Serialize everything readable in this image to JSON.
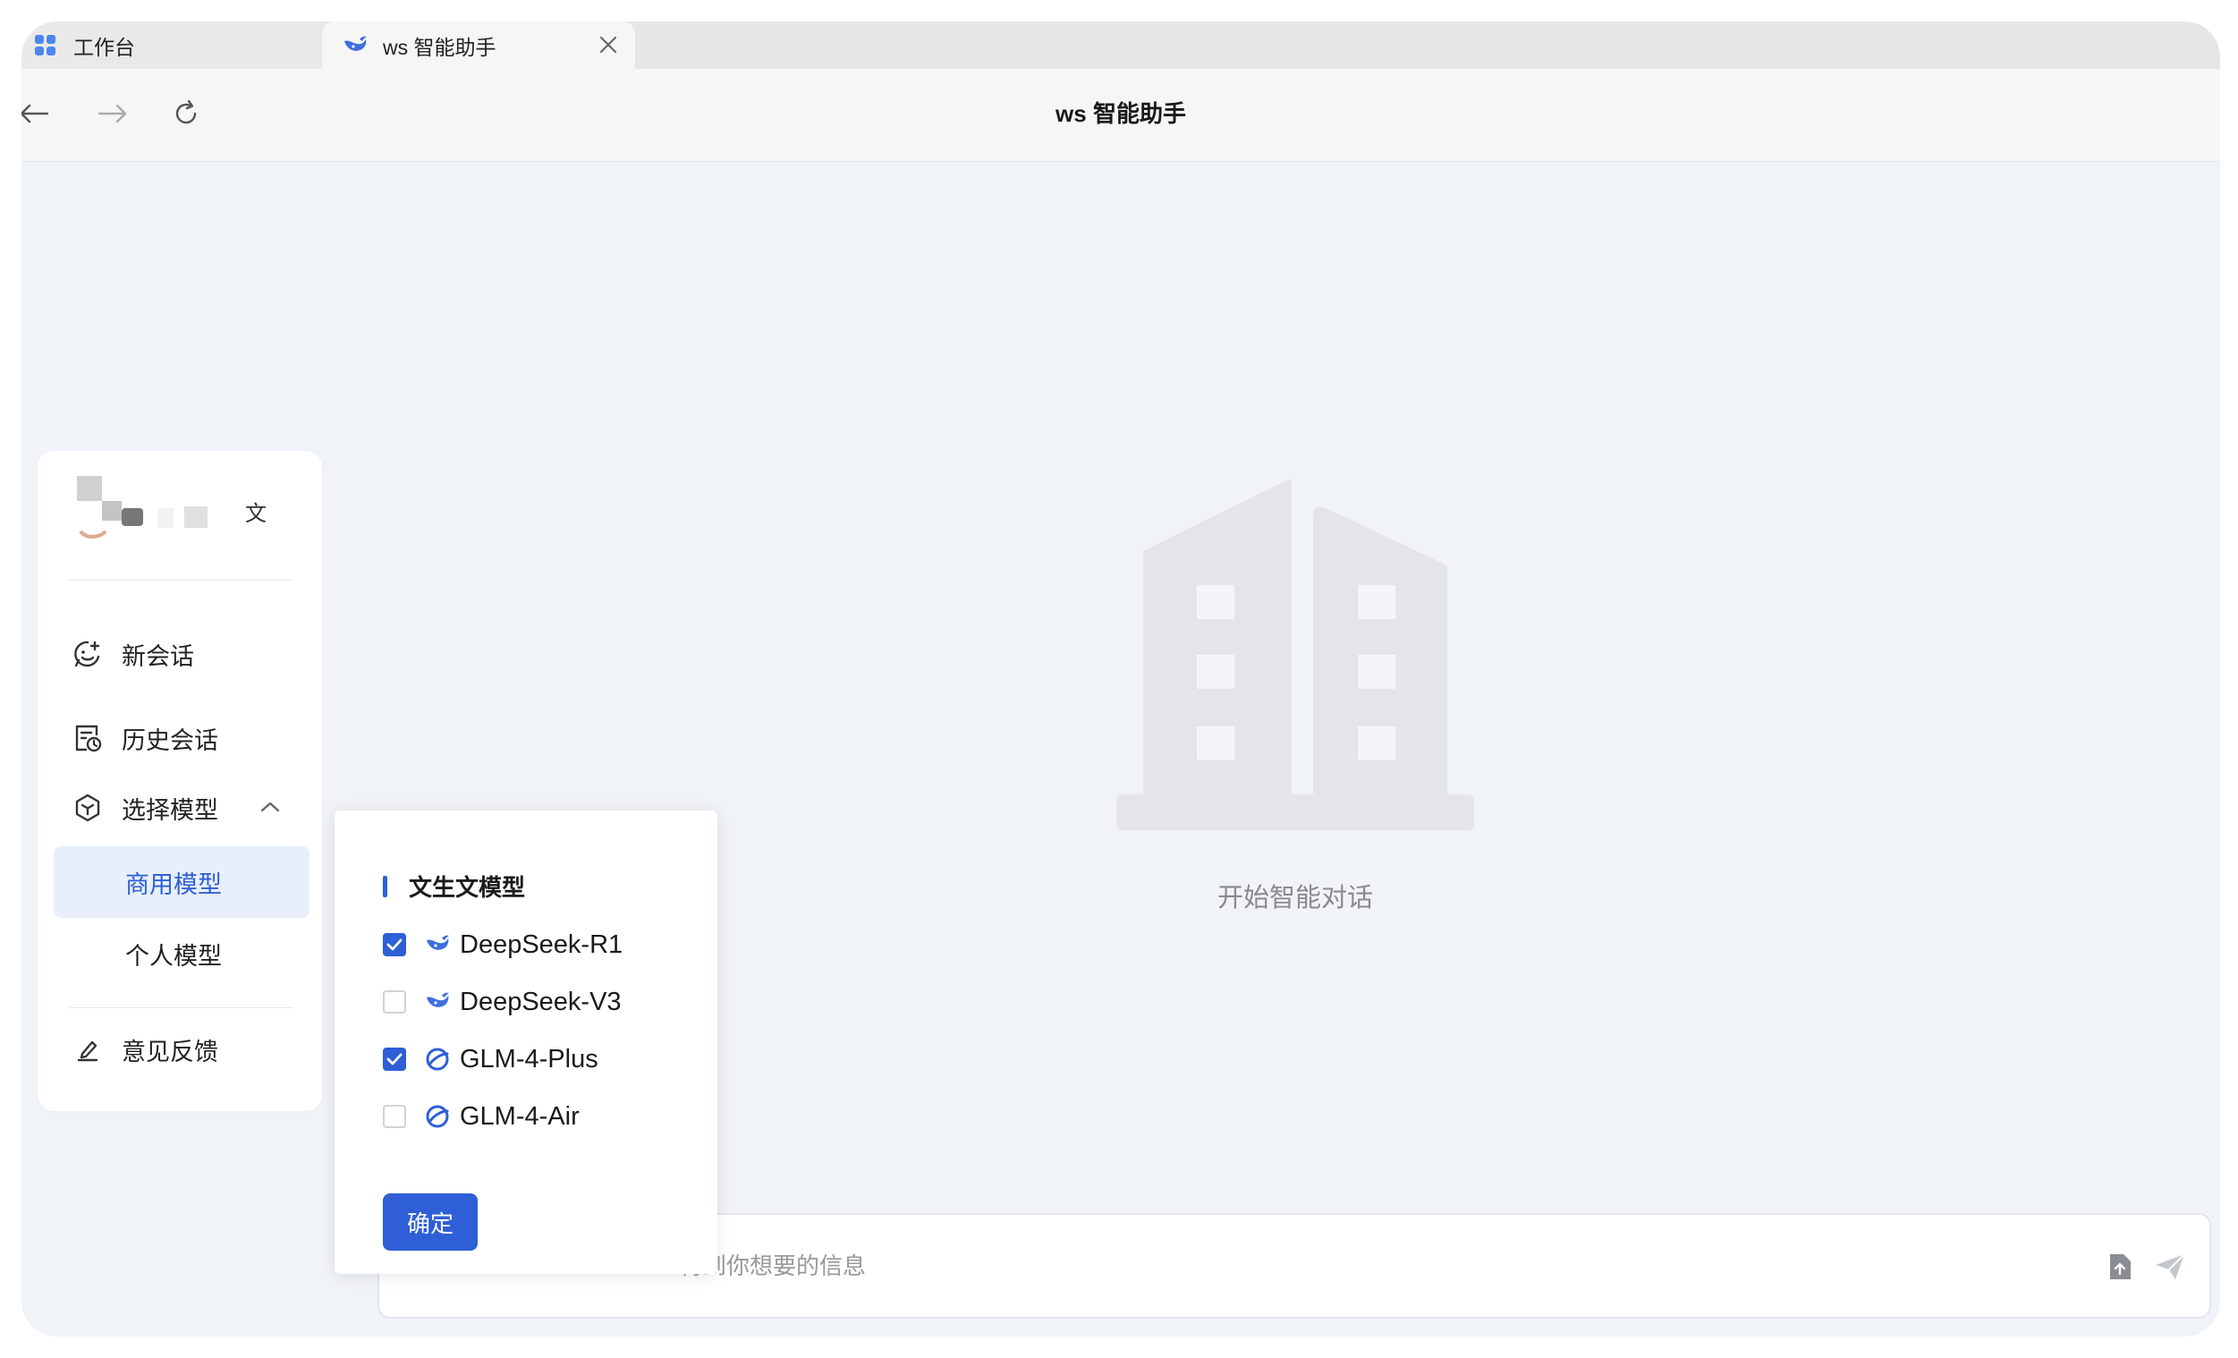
{
  "tabs": [
    {
      "label": "工作台",
      "icon": "app-grid-icon"
    },
    {
      "label": "ws 智能助手",
      "icon": "whale-logo-icon",
      "active": true
    }
  ],
  "nav": {
    "title": "ws 智能助手"
  },
  "sidebar": {
    "user_name_tail": "文",
    "items": [
      {
        "label": "新会话",
        "icon": "new-chat-icon"
      },
      {
        "label": "历史会话",
        "icon": "history-icon"
      },
      {
        "label": "选择模型",
        "icon": "model-cube-icon",
        "expanded": true
      }
    ],
    "model_submenu": [
      {
        "label": "商用模型",
        "selected": true
      },
      {
        "label": "个人模型",
        "selected": false
      }
    ],
    "feedback": {
      "label": "意见反馈",
      "icon": "edit-pen-icon"
    }
  },
  "main": {
    "empty_text": "开始智能对话"
  },
  "input": {
    "visible_text": "得到你想要的信息"
  },
  "popup": {
    "header": "文生文模型",
    "models": [
      {
        "name": "DeepSeek-R1",
        "checked": true,
        "icon": "deepseek-icon"
      },
      {
        "name": "DeepSeek-V3",
        "checked": false,
        "icon": "deepseek-icon"
      },
      {
        "name": "GLM-4-Plus",
        "checked": true,
        "icon": "glm-icon"
      },
      {
        "name": "GLM-4-Air",
        "checked": false,
        "icon": "glm-icon"
      }
    ],
    "confirm_label": "确定"
  },
  "colors": {
    "accent": "#2e5fd6",
    "page_bg": "#f0f3f8",
    "selected_bg": "#e8effa"
  }
}
